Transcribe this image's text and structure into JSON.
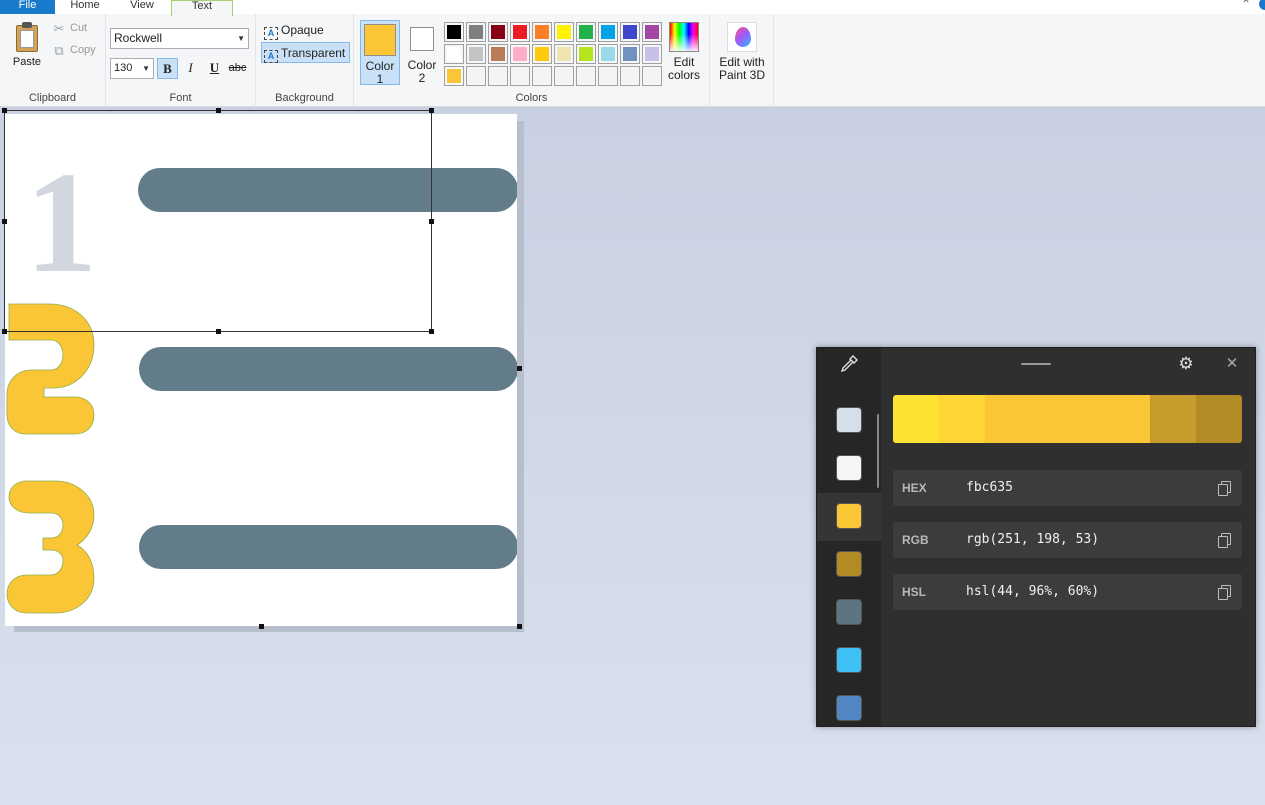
{
  "tabs": {
    "file": "File",
    "home": "Home",
    "view": "View",
    "text": "Text"
  },
  "clipboard": {
    "paste": "Paste",
    "cut": "Cut",
    "copy": "Copy",
    "label": "Clipboard"
  },
  "font": {
    "family": "Rockwell",
    "size": "130",
    "bold": "B",
    "italic": "I",
    "underline": "U",
    "strike": "abc",
    "label": "Font"
  },
  "background": {
    "opaque": "Opaque",
    "transparent": "Transparent",
    "label": "Background"
  },
  "colors": {
    "color1_line1": "Color",
    "color1_line2": "1",
    "color1_value": "#fbc635",
    "color2_line1": "Color",
    "color2_line2": "2",
    "color2_value": "#ffffff",
    "edit_line1": "Edit",
    "edit_line2": "colors",
    "paint3d_line1": "Edit with",
    "paint3d_line2": "Paint 3D",
    "label": "Colors",
    "palette_row1": [
      "#000000",
      "#7f7f7f",
      "#880015",
      "#ed1c24",
      "#ff7f27",
      "#fff200",
      "#22b14c",
      "#00a2e8",
      "#3f48cc",
      "#a349a4"
    ],
    "palette_row2": [
      "#ffffff",
      "#c3c3c3",
      "#b97a57",
      "#ffaec9",
      "#ffc90e",
      "#efe4b0",
      "#b5e61d",
      "#99d9ea",
      "#7092be",
      "#c8bfe7"
    ],
    "palette_row3": [
      "#fbc635",
      "#f4f4f4",
      "#f4f4f4",
      "#f4f4f4",
      "#f4f4f4",
      "#f4f4f4",
      "#f4f4f4",
      "#f4f4f4",
      "#f4f4f4",
      "#f4f4f4"
    ]
  },
  "canvas": {
    "digit_one": "1",
    "digit_two": "2",
    "digit_three": "3",
    "bar_color": "#627d89",
    "digit_color": "#fbc635",
    "faded_digit_color": "#d1d6df"
  },
  "picker": {
    "history": [
      "#d6deea",
      "#f5f5f5",
      "#fbc635",
      "#b38b24",
      "#5d7581",
      "#40c1f5",
      "#5387c3"
    ],
    "shades": [
      "#fde232",
      "#fdd534",
      "#fbc635",
      "#fbc635",
      "#c69d2c",
      "#b28b24"
    ],
    "hex_label": "HEX",
    "hex_value": "fbc635",
    "rgb_label": "RGB",
    "rgb_value": "rgb(251, 198, 53)",
    "hsl_label": "HSL",
    "hsl_value": "hsl(44, 96%, 60%)"
  }
}
